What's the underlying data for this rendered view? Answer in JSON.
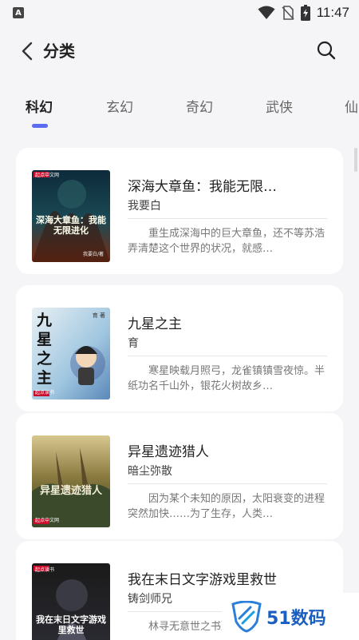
{
  "status_bar": {
    "app_icon_letter": "A",
    "time": "11:47"
  },
  "header": {
    "title": "分类"
  },
  "tabs": [
    {
      "label": "科幻",
      "active": true
    },
    {
      "label": "玄幻",
      "active": false
    },
    {
      "label": "奇幻",
      "active": false
    },
    {
      "label": "武侠",
      "active": false
    },
    {
      "label": "仙",
      "active": false
    }
  ],
  "books": [
    {
      "title": "深海大章鱼：我能无限…",
      "author": "我要白",
      "description": "重生成深海中的巨大章鱼，还不等苏浩弄清楚这个世界的状况，就感…",
      "cover_text": "深海大章鱼：我能无限进化",
      "cover_author": "我要白/著",
      "cover_badge": "起点中文网"
    },
    {
      "title": "九星之主",
      "author": "育",
      "description": "寒星映载月照弓，龙雀镇镇雪夜惊。半纸功名千山外，银花火树故乡…",
      "cover_text": "九星之主",
      "cover_author": "育 著",
      "cover_badge": "起点读书"
    },
    {
      "title": "异星遗迹猎人",
      "author": "暗尘弥散",
      "description": "因为某个未知的原因，太阳衰变的进程突然加快……为了生存，人类…",
      "cover_text": "异星遗迹猎人",
      "cover_author": "暗尘弥散",
      "cover_badge": "起点中文网"
    },
    {
      "title": "我在末日文字游戏里救世",
      "author": "铸剑师兄",
      "description": "林寻无意世之书》的文",
      "cover_text": "我在末日文字游戏里救世",
      "cover_author": "",
      "cover_badge": "起点读书"
    }
  ],
  "watermark": {
    "text": "51数码"
  },
  "colors": {
    "accent": "#5b6cf0",
    "background": "#f5f5f7",
    "card": "#ffffff",
    "watermark": "#1a5fbf"
  },
  "icons": {
    "back": "chevron-left-icon",
    "search": "search-icon",
    "wifi": "wifi-icon",
    "no_sim": "no-sim-icon",
    "battery": "battery-charging-icon"
  }
}
